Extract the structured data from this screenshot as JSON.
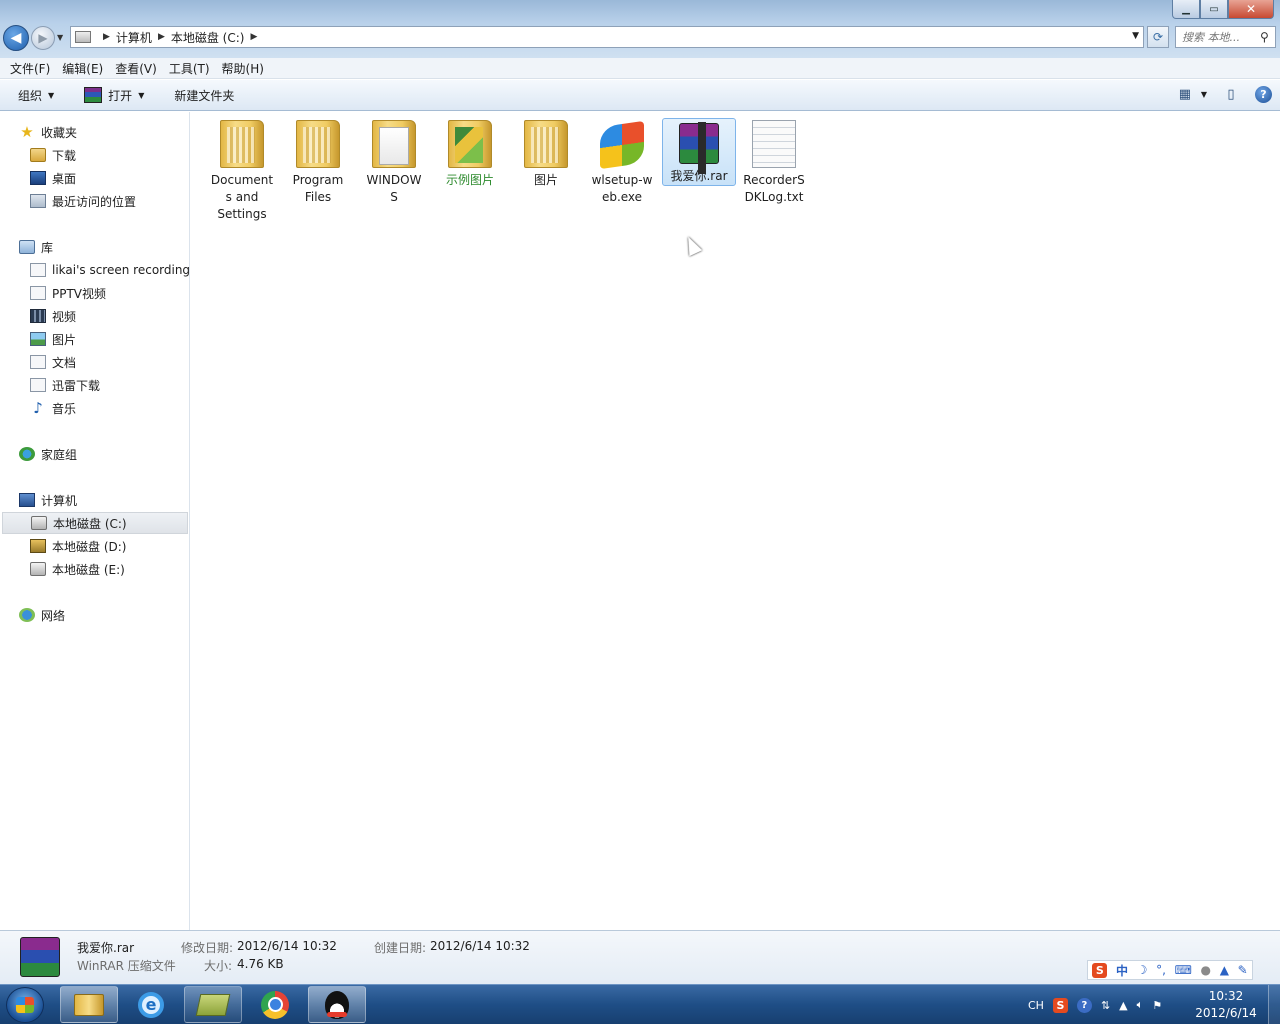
{
  "window": {
    "controls": {
      "minimize": "▁",
      "maximize": "▭",
      "close": "✕"
    }
  },
  "address": {
    "crumbs": [
      "计算机",
      "本地磁盘 (C:)"
    ],
    "search_placeholder": "搜索 本地..."
  },
  "menu": [
    "文件(F)",
    "编辑(E)",
    "查看(V)",
    "工具(T)",
    "帮助(H)"
  ],
  "toolbar": {
    "organize": "组织",
    "open": "打开",
    "new_folder": "新建文件夹"
  },
  "sidebar": {
    "favorites": {
      "label": "收藏夹",
      "items": [
        "下载",
        "桌面",
        "最近访问的位置"
      ]
    },
    "libraries": {
      "label": "库",
      "items": [
        "likai's screen recording",
        "PPTV视频",
        "视频",
        "图片",
        "文档",
        "迅雷下载",
        "音乐"
      ]
    },
    "homegroup": {
      "label": "家庭组"
    },
    "computer": {
      "label": "计算机",
      "items": [
        "本地磁盘 (C:)",
        "本地磁盘 (D:)",
        "本地磁盘 (E:)"
      ]
    },
    "network": {
      "label": "网络"
    }
  },
  "files": [
    {
      "name": "Document\ns and\nSettings",
      "kind": "folder"
    },
    {
      "name": "Program\nFiles",
      "kind": "folder"
    },
    {
      "name": "WINDOW\nS",
      "kind": "folder-win"
    },
    {
      "name": "示例图片",
      "kind": "folder-pic"
    },
    {
      "name": "图片",
      "kind": "folder"
    },
    {
      "name": "wlsetup-w\neb.exe",
      "kind": "exe"
    },
    {
      "name": "我爱你.rar",
      "kind": "rar"
    },
    {
      "name": "RecorderS\nDKLog.txt",
      "kind": "txt"
    }
  ],
  "details": {
    "name": "我爱你.rar",
    "type": "WinRAR 压缩文件",
    "modified_label": "修改日期:",
    "modified": "2012/6/14 10:32",
    "created_label": "创建日期:",
    "created": "2012/6/14 10:32",
    "size_label": "大小:",
    "size": "4.76 KB"
  },
  "ime": {
    "s": "S",
    "chinese": "中"
  },
  "tray": {
    "lang": "CH",
    "s": "S",
    "help": "?"
  },
  "clock": {
    "time": "10:32",
    "date": "2012/6/14"
  }
}
